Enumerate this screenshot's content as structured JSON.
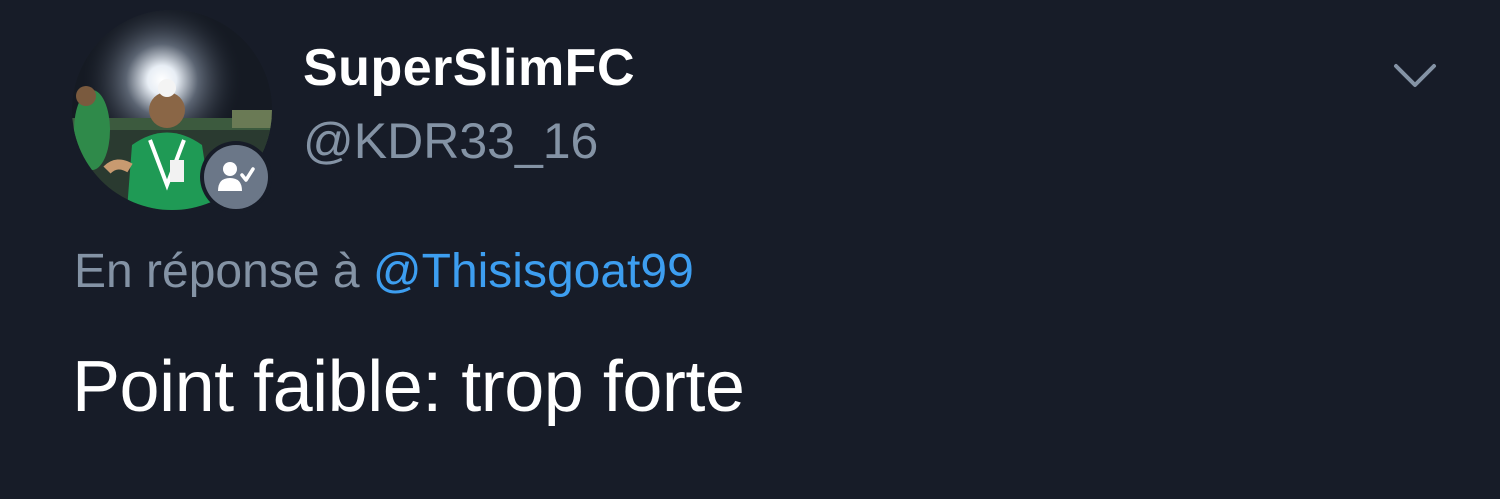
{
  "tweet": {
    "author": {
      "display_name": "SuperSlimFC",
      "handle": "@KDR33_16",
      "avatar_icon": "profile-photo",
      "badge_icon": "follows-you-icon"
    },
    "reply": {
      "prefix": "En réponse à",
      "mention": "@Thisisgoat99"
    },
    "text": "Point faible: trop forte",
    "menu_icon": "chevron-down-icon"
  },
  "colors": {
    "background": "#171c28",
    "name": "#ffffff",
    "secondary": "#8493a5",
    "link": "#3d9ef0"
  }
}
